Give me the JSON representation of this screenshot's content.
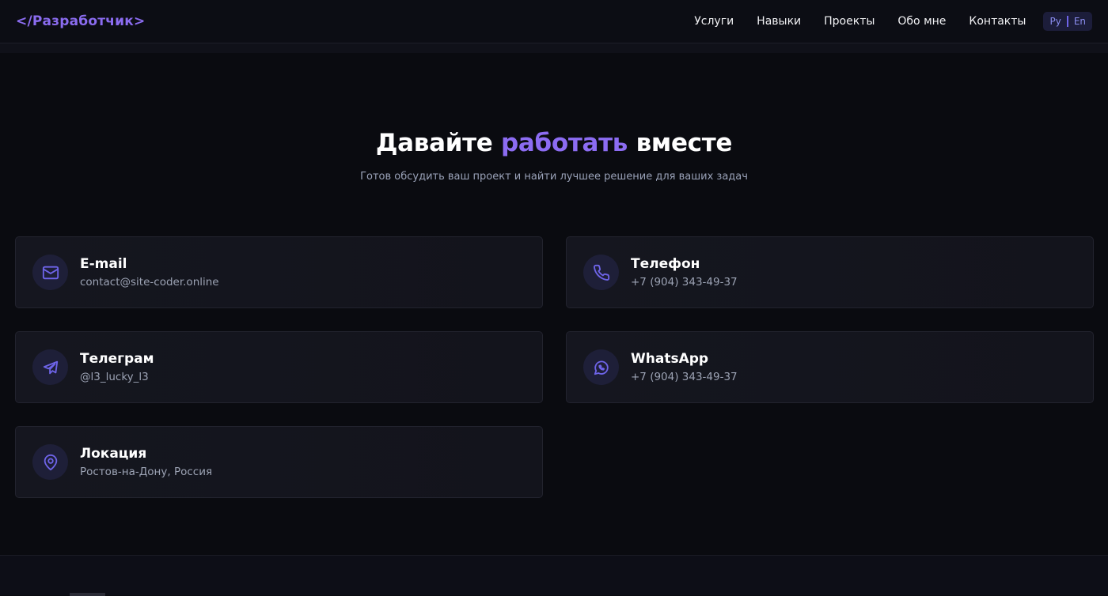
{
  "navbar": {
    "logo": "</Разработчик>",
    "links": [
      "Услуги",
      "Навыки",
      "Проекты",
      "Обо мне",
      "Контакты"
    ],
    "lang": {
      "ru": "Ру",
      "en": "En"
    }
  },
  "hero": {
    "title_part1": "Давайте ",
    "title_accent": "работать",
    "title_part2": " вместе",
    "subtitle": "Готов обсудить ваш проект и найти лучшее решение для ваших задач"
  },
  "contacts": [
    {
      "id": "email",
      "title": "E-mail",
      "value": "contact@site-coder.online",
      "icon": "mail-icon"
    },
    {
      "id": "phone",
      "title": "Телефон",
      "value": "+7 (904) 343-49-37",
      "icon": "phone-icon"
    },
    {
      "id": "telegram",
      "title": "Телеграм",
      "value": "@l3_lucky_l3",
      "icon": "telegram-icon"
    },
    {
      "id": "whatsapp",
      "title": "WhatsApp",
      "value": "+7 (904) 343-49-37",
      "icon": "whatsapp-icon"
    },
    {
      "id": "location",
      "title": "Локация",
      "value": "Ростов-на-Дону, Россия",
      "icon": "location-pin-icon"
    }
  ],
  "colors": {
    "accent": "#8c6cf2",
    "icon": "#6e64e8",
    "background": "#0a0b10"
  }
}
